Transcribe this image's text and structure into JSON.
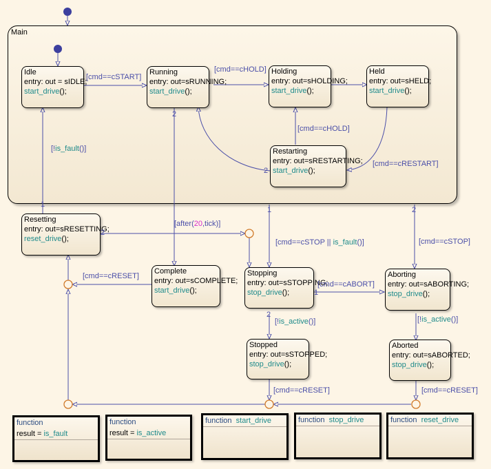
{
  "chart": {
    "title": "Main"
  },
  "states": {
    "idle": {
      "name": "Idle",
      "entry": "entry: out = sIDLE;",
      "call": "start_drive",
      "call_suffix": "();"
    },
    "running": {
      "name": "Running",
      "entry": "entry: out=sRUNNING;",
      "call": "start_drive",
      "call_suffix": "();"
    },
    "holding": {
      "name": "Holding",
      "entry": "entry: out=sHOLDING;",
      "call": "start_drive",
      "call_suffix": "();"
    },
    "held": {
      "name": "Held",
      "entry": "entry: out=sHELD;",
      "call": "start_drive",
      "call_suffix": "();"
    },
    "restarting": {
      "name": "Restarting",
      "entry": "entry: out=sRESTARTING;",
      "call": "start_drive",
      "call_suffix": "();"
    },
    "resetting": {
      "name": "Resetting",
      "entry": "entry: out=sRESETTING;",
      "call": "reset_drive",
      "call_suffix": "();"
    },
    "complete": {
      "name": "Complete",
      "entry": "entry: out=sCOMPLETE;",
      "call": "start_drive",
      "call_suffix": "();"
    },
    "stopping": {
      "name": "Stopping",
      "entry": "entry: out=sSTOPPING;",
      "call": "stop_drive",
      "call_suffix": "();"
    },
    "aborting": {
      "name": "Aborting",
      "entry": "entry: out=sABORTING;",
      "call": "stop_drive",
      "call_suffix": "();"
    },
    "stopped": {
      "name": "Stopped",
      "entry": "entry: out=sSTOPPED;",
      "call": "stop_drive",
      "call_suffix": "();"
    },
    "aborted": {
      "name": "Aborted",
      "entry": "entry: out=sABORTED;",
      "call": "stop_drive",
      "call_suffix": "();"
    }
  },
  "transitions": {
    "idle_running": "[cmd==cSTART]",
    "running_holding": "[cmd==cHOLD]",
    "restarting_holding": "[cmd==cHOLD]",
    "held_restarting": "[cmd==cRESTART]",
    "main_resetting": {
      "open": "[!",
      "fn": "is_fault",
      "close": "()]"
    },
    "resetting_after": {
      "open": "[after(",
      "num": "20",
      "close": ",tick)]"
    },
    "main_stopping": {
      "open": "[cmd==cSTOP || ",
      "fn": "is_fault",
      "close": "()]"
    },
    "main_aborting": "[cmd==cSTOP]",
    "stopping_aborting": "[cmd==cABORT]",
    "complete_reset": "[cmd==cRESET]",
    "stopping_stopped": {
      "open": "[!",
      "fn": "is_active",
      "close": "()]"
    },
    "aborting_aborted": {
      "open": "[!",
      "fn": "is_active",
      "close": "()]"
    },
    "stopped_reset": "[cmd==cRESET]",
    "aborted_reset": "[cmd==cRESET]"
  },
  "priorities": {
    "one": "1",
    "two": "2"
  },
  "functions": [
    {
      "keyword": "function",
      "signature_prefix": "result = ",
      "name": "is_fault"
    },
    {
      "keyword": "function",
      "signature_prefix": "result = ",
      "name": "is_active"
    },
    {
      "keyword": "function",
      "name": "start_drive"
    },
    {
      "keyword": "function",
      "name": "stop_drive"
    },
    {
      "keyword": "function",
      "name": "reset_drive"
    }
  ],
  "colors": {
    "wire": "#4a4ea8",
    "junction": "#d07a2a",
    "default_dot": "#3c3f9e",
    "function_name": "#1e8a8a"
  }
}
